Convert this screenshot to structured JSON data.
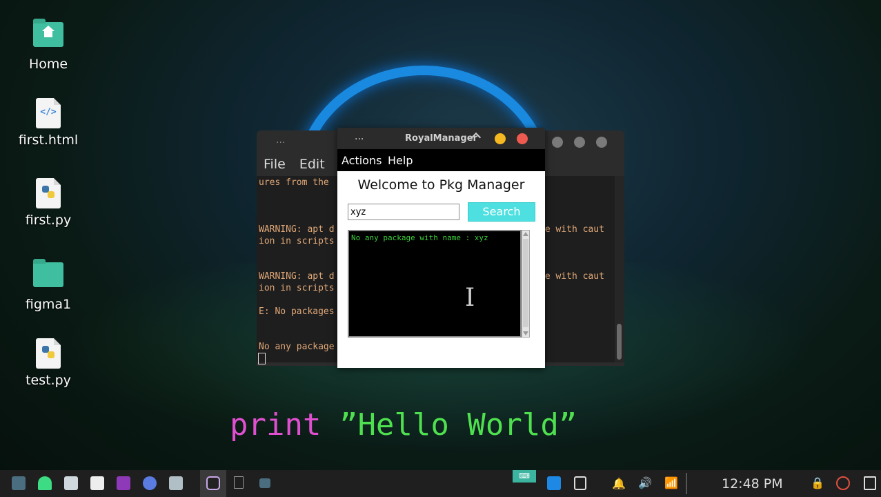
{
  "desktop": {
    "icons": [
      {
        "label": "Home",
        "kind": "folder-home-icon"
      },
      {
        "label": "first.html",
        "kind": "html-file-icon"
      },
      {
        "label": "first.py",
        "kind": "python-file-icon"
      },
      {
        "label": "figma1",
        "kind": "folder-icon"
      },
      {
        "label": "test.py",
        "kind": "python-file-icon"
      }
    ],
    "wallpaper_text": {
      "keyword": "print",
      "string": "”Hello World”"
    }
  },
  "terminal": {
    "dots": "...",
    "menu": {
      "file": "File",
      "edit": "Edit"
    },
    "lines": [
      "ures from the",
      "WARNING: apt d                                      se with caut",
      "ion in scripts",
      "WARNING: apt d                                      se with caut",
      "ion in scripts",
      "E: No packages",
      "No any package"
    ]
  },
  "royal": {
    "dots": "...",
    "title": "RoyalManager",
    "menu": {
      "actions": "Actions",
      "help": "Help"
    },
    "welcome": "Welcome to Pkg Manager",
    "search_value": "xyz",
    "search_button": "Search",
    "output": "No any package with name : xyz"
  },
  "taskbar": {
    "clock": "12:48 PM",
    "colors": {
      "accent": "#4ee0e0",
      "close": "#ee5a4f",
      "minimize": "#f5b820",
      "string_green": "#4fe04f",
      "keyword_pink": "#e04fd0"
    }
  }
}
